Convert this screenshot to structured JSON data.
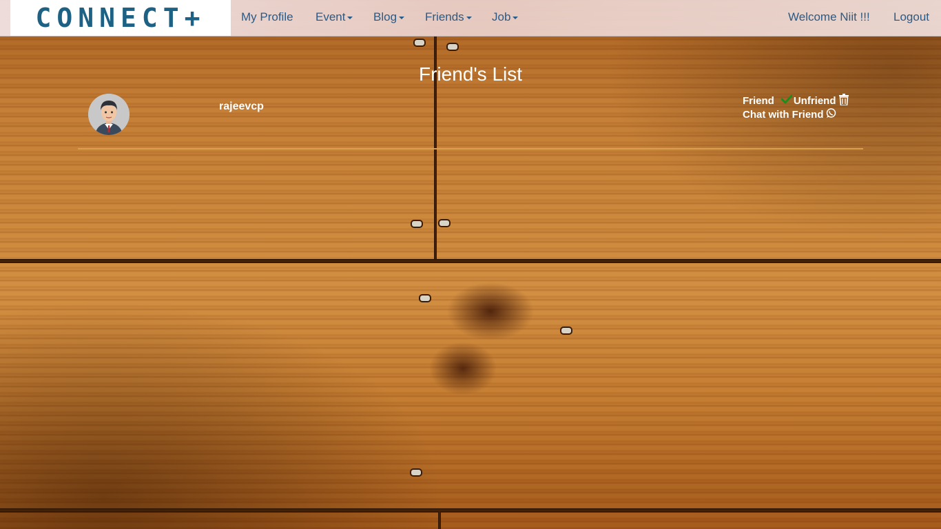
{
  "navbar": {
    "brand": "CONNECT+",
    "items": [
      {
        "label": "My Profile",
        "dropdown": false
      },
      {
        "label": "Event",
        "dropdown": true
      },
      {
        "label": "Blog",
        "dropdown": true
      },
      {
        "label": "Friends",
        "dropdown": true
      },
      {
        "label": "Job",
        "dropdown": true
      }
    ],
    "welcome": "Welcome Niit !!!",
    "logout": "Logout"
  },
  "page": {
    "title": "Friend's List"
  },
  "friends": [
    {
      "name": "rajeevcp",
      "status": "Friend",
      "unfriend_label": "Unfriend",
      "chat_label": "Chat with Friend",
      "icons": [
        "check-icon",
        "trash-icon",
        "whatsapp-icon"
      ]
    }
  ],
  "colors": {
    "nav_link": "#2b5a86",
    "brand": "#1d6285",
    "check": "#1e8c1e",
    "divider": "#d9a050"
  }
}
